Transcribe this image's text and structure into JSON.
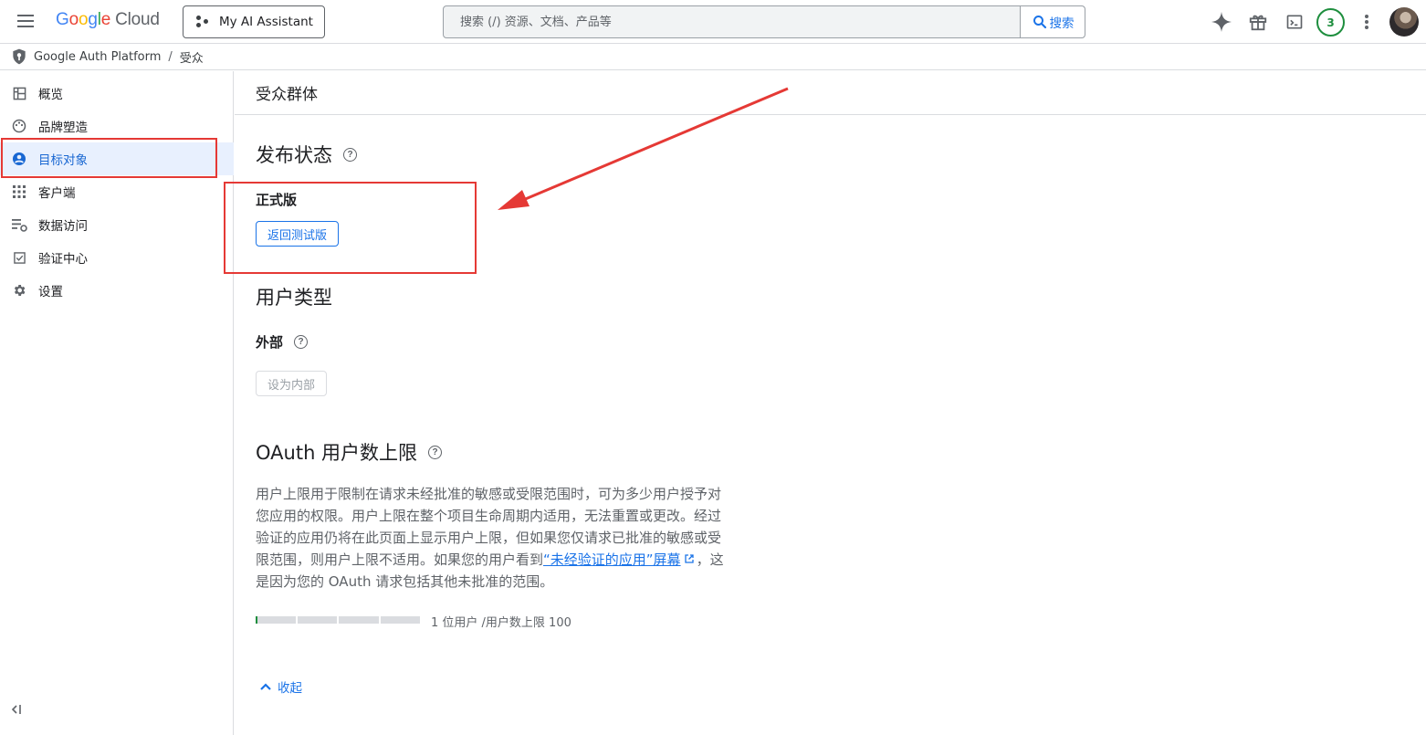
{
  "topbar": {
    "logo_google": "Google",
    "logo_cloud": "Cloud",
    "assistant_label": "My AI Assistant",
    "search_placeholder": "搜索 (/) 资源、文档、产品等",
    "search_button": "搜索",
    "notification_count": "3",
    "icons": [
      "menu-icon",
      "gemini-sparkle-icon",
      "gift-icon",
      "terminal-icon",
      "more-vert-icon"
    ]
  },
  "breadcrumb": {
    "items": [
      "Google Auth Platform",
      "受众"
    ],
    "separator": "/"
  },
  "sidebar": {
    "items": [
      {
        "label": "概览",
        "icon": "dashboard-icon"
      },
      {
        "label": "品牌塑造",
        "icon": "palette-icon"
      },
      {
        "label": "目标对象",
        "icon": "person-icon",
        "active": true
      },
      {
        "label": "客户端",
        "icon": "apps-icon"
      },
      {
        "label": "数据访问",
        "icon": "data-access-icon"
      },
      {
        "label": "验证中心",
        "icon": "checkbox-icon"
      },
      {
        "label": "设置",
        "icon": "settings-icon"
      }
    ],
    "collapse_icon": "collapse-left-icon"
  },
  "main": {
    "header": "受众群体",
    "publish": {
      "title": "发布状态",
      "status": "正式版",
      "button": "返回测试版"
    },
    "user_type": {
      "title": "用户类型",
      "value": "外部",
      "button": "设为内部"
    },
    "oauth_cap": {
      "title": "OAuth 用户数上限",
      "desc_before": "用户上限用于限制在请求未经批准的敏感或受限范围时，可为多少用户授予对您应用的权限。用户上限在整个项目生命周期内适用，无法重置或更改。经过验证的应用仍将在此页面上显示用户上限，但如果您仅请求已批准的敏感或受限范围，则用户上限不适用。如果您的用户看到",
      "link": "“未经验证的应用”屏幕",
      "desc_after": "，这是因为您的 OAuth 请求包括其他未批准的范围。",
      "progress_label": "1 位用户 /用户数上限 100",
      "users": 1,
      "limit": 100
    },
    "collapse": "收起"
  },
  "colors": {
    "accent": "#1a73e8",
    "active_bg": "#e8f0fe",
    "annotation_red": "#e53935",
    "progress_green": "#1e8e3e"
  }
}
